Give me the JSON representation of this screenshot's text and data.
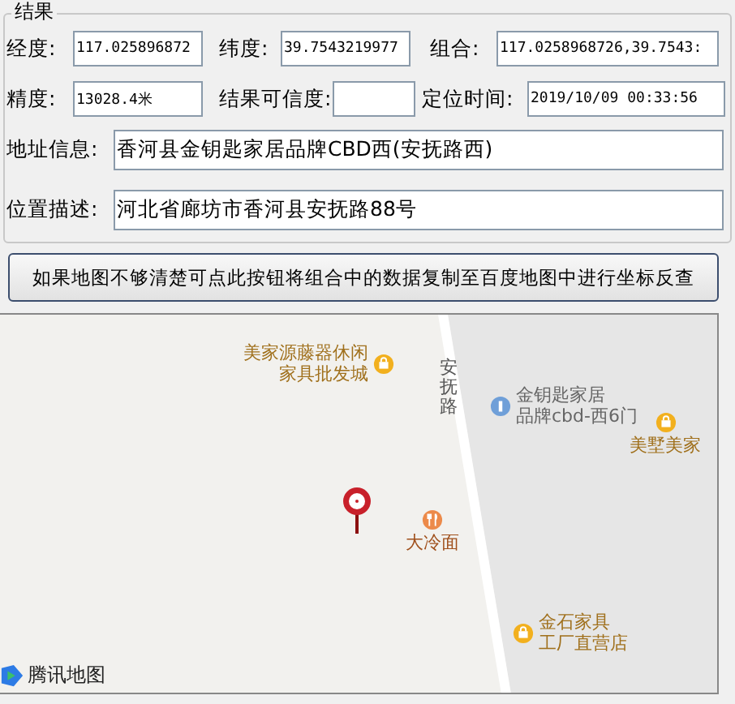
{
  "group": {
    "title": "结果",
    "rows": [
      {
        "fields": [
          {
            "label": "经度:",
            "value": "117.025896872"
          },
          {
            "label": "纬度:",
            "value": "39.7543219977"
          },
          {
            "label": "组合:",
            "value": "117.0258968726,39.7543:"
          }
        ]
      },
      {
        "fields": [
          {
            "label": "精度:",
            "value": "13028.4米"
          },
          {
            "label": "结果可信度:"
          },
          {
            "label": "定位时间:",
            "value": "2019/10/09 00:33:56"
          }
        ]
      },
      {
        "fields": [
          {
            "label": "地址信息:",
            "value": "香河县金钥匙家居品牌CBD西(安抚路西)"
          }
        ]
      },
      {
        "fields": [
          {
            "label": "位置描述:",
            "value": "河北省廊坊市香河县安抚路88号"
          }
        ]
      }
    ]
  },
  "button": {
    "label": "如果地图不够清楚可点此按钮将组合中的数据复制至百度地图中进行坐标反查"
  },
  "map": {
    "road_label": "安抚路",
    "pois": [
      {
        "kind": "shop",
        "lines": [
          "美家源藤器休闲",
          "家具批发城"
        ]
      },
      {
        "kind": "place",
        "lines": [
          "金钥匙家居",
          "品牌cbd-西6门"
        ]
      },
      {
        "kind": "shop",
        "lines": [
          "美墅美家"
        ]
      },
      {
        "kind": "food",
        "lines": [
          "大冷面"
        ]
      },
      {
        "kind": "shop",
        "lines": [
          "金石家具",
          "工厂直营店"
        ]
      }
    ],
    "logo": "腾讯地图"
  }
}
